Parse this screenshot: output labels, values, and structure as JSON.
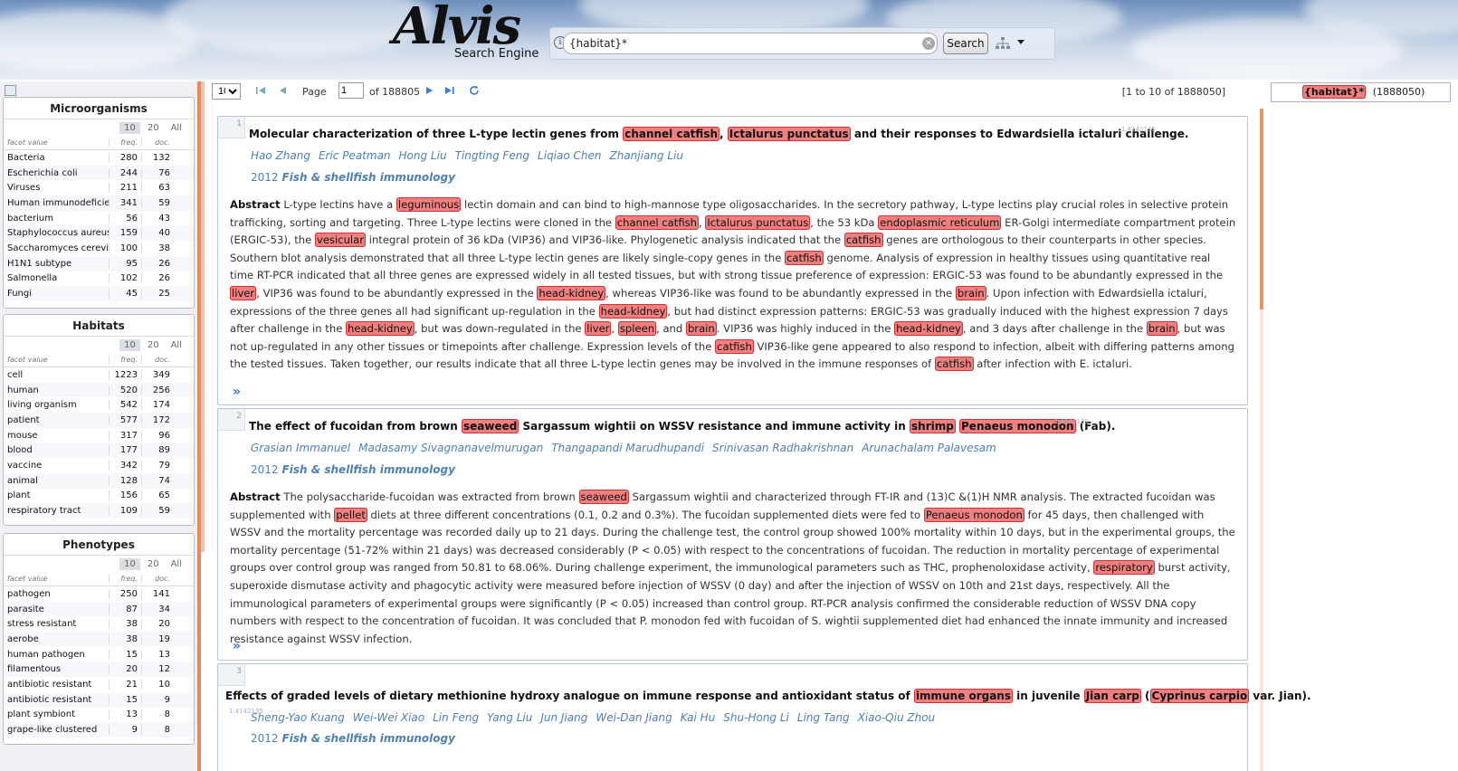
{
  "header": {
    "logo_main": "Alvis",
    "logo_sub": "Search Engine",
    "search_value": "{habitat}*",
    "search_button": "Search"
  },
  "toolbar": {
    "page_size": "10",
    "page_label": "Page",
    "page_value": "1",
    "page_total": "of 188805",
    "range": "[1 to 10 of 1888050]"
  },
  "query_chip": {
    "term": "{habitat}*",
    "count": "(1888050)"
  },
  "facets": [
    {
      "title": "Microorganisms",
      "limits": [
        "10",
        "20",
        "All"
      ],
      "headers": [
        "facet value",
        "freq.",
        "doc."
      ],
      "rows": [
        [
          "Bacteria",
          "280",
          "132"
        ],
        [
          "Escherichia coli",
          "244",
          "76"
        ],
        [
          "Viruses",
          "211",
          "63"
        ],
        [
          "Human immunodeficier",
          "341",
          "59"
        ],
        [
          "bacterium",
          "56",
          "43"
        ],
        [
          "Staphylococcus aureus",
          "159",
          "40"
        ],
        [
          "Saccharomyces cerevis",
          "100",
          "38"
        ],
        [
          "H1N1 subtype",
          "95",
          "26"
        ],
        [
          "Salmonella",
          "102",
          "26"
        ],
        [
          "Fungi",
          "45",
          "25"
        ]
      ]
    },
    {
      "title": "Habitats",
      "limits": [
        "10",
        "20",
        "All"
      ],
      "headers": [
        "facet value",
        "freq.",
        "doc."
      ],
      "rows": [
        [
          "cell",
          "1223",
          "349"
        ],
        [
          "human",
          "520",
          "256"
        ],
        [
          "living organism",
          "542",
          "174"
        ],
        [
          "patient",
          "577",
          "172"
        ],
        [
          "mouse",
          "317",
          "96"
        ],
        [
          "blood",
          "177",
          "89"
        ],
        [
          "vaccine",
          "342",
          "79"
        ],
        [
          "animal",
          "128",
          "74"
        ],
        [
          "plant",
          "156",
          "65"
        ],
        [
          "respiratory tract",
          "109",
          "59"
        ]
      ]
    },
    {
      "title": "Phenotypes",
      "limits": [
        "10",
        "20",
        "All"
      ],
      "headers": [
        "facet value",
        "freq.",
        "doc."
      ],
      "rows": [
        [
          "pathogen",
          "250",
          "141"
        ],
        [
          "parasite",
          "87",
          "34"
        ],
        [
          "stress resistant",
          "38",
          "20"
        ],
        [
          "aerobe",
          "38",
          "19"
        ],
        [
          "human pathogen",
          "15",
          "13"
        ],
        [
          "filamentous",
          "20",
          "12"
        ],
        [
          "antibiotic resistant",
          "21",
          "10"
        ],
        [
          "antibiotic resistant",
          "15",
          "9"
        ],
        [
          "plant symbiont",
          "13",
          "8"
        ],
        [
          "grape-like clustered",
          "9",
          "8"
        ]
      ]
    }
  ],
  "results": [
    {
      "rank": "1",
      "docid": "1.4142135",
      "title_parts": [
        [
          "Molecular characterization of three L-type lectin genes from ",
          false
        ],
        [
          "channel catfish",
          true
        ],
        [
          ", ",
          false
        ],
        [
          "Ictalurus punctatus",
          true
        ],
        [
          " and their responses to Edwardsiella ictaluri challenge.",
          false
        ]
      ],
      "authors": [
        "Hao Zhang",
        "Eric Peatman",
        "Hong Liu",
        "Tingting Feng",
        "Liqiao Chen",
        "Zhanjiang Liu"
      ],
      "year": "2012",
      "journal": "Fish & shellfish immunology",
      "abstract_label": "Abstract",
      "abstract_parts": [
        [
          " L-type lectins have a ",
          false
        ],
        [
          "leguminous",
          true
        ],
        [
          " lectin domain and can bind to high-mannose type oligosaccharides. In the secretory pathway, L-type lectins play crucial roles in selective protein trafficking, sorting and targeting. Three L-type lectins were cloned in the ",
          false
        ],
        [
          "channel catfish",
          true
        ],
        [
          ", ",
          false
        ],
        [
          "Ictalurus punctatus",
          true
        ],
        [
          ", the 53 kDa ",
          false
        ],
        [
          "endoplasmic reticulum",
          true
        ],
        [
          " ER-Golgi intermediate compartment protein (ERGIC-53), the ",
          false
        ],
        [
          "vesicular",
          true
        ],
        [
          " integral protein of 36 kDa (VIP36) and VIP36-like. Phylogenetic analysis indicated that the ",
          false
        ],
        [
          "catfish",
          true
        ],
        [
          " genes are orthologous to their counterparts in other species. Southern blot analysis demonstrated that all three L-type lectin genes are likely single-copy genes in the ",
          false
        ],
        [
          "catfish",
          true
        ],
        [
          " genome. Analysis of expression in healthy tissues using quantitative real time RT-PCR indicated that all three genes are expressed widely in all tested tissues, but with strong tissue preference of expression: ERGIC-53 was found to be abundantly expressed in the ",
          false
        ],
        [
          "liver",
          true
        ],
        [
          ", VIP36 was found to be abundantly expressed in the ",
          false
        ],
        [
          "head-kidney",
          true
        ],
        [
          ", whereas VIP36-like was found to be abundantly expressed in the ",
          false
        ],
        [
          "brain",
          true
        ],
        [
          ". Upon infection with Edwardsiella ictaluri, expressions of the three genes all had significant up-regulation in the ",
          false
        ],
        [
          "head-kidney",
          true
        ],
        [
          ", but had distinct expression patterns: ERGIC-53 was gradually induced with the highest expression 7 days after challenge in the ",
          false
        ],
        [
          "head-kidney",
          true
        ],
        [
          ", but was down-regulated in the ",
          false
        ],
        [
          "liver",
          true
        ],
        [
          ", ",
          false
        ],
        [
          "spleen",
          true
        ],
        [
          ", and ",
          false
        ],
        [
          "brain",
          true
        ],
        [
          ". VIP36 was highly induced in the ",
          false
        ],
        [
          "head-kidney",
          true
        ],
        [
          ", and 3 days after challenge in the ",
          false
        ],
        [
          "brain",
          true
        ],
        [
          ", but was not up-regulated in any other tissues or timepoints after challenge. Expression levels of the ",
          false
        ],
        [
          "catfish",
          true
        ],
        [
          " VIP36-like gene appeared to also respond to infection, albeit with differing patterns among the tested tissues. Taken together, our results indicate that all three L-type lectin genes may be involved in the immune responses of ",
          false
        ],
        [
          "catfish",
          true
        ],
        [
          " after infection with E. ictaluri.",
          false
        ]
      ]
    },
    {
      "rank": "2",
      "docid": "1.4142135",
      "title_parts": [
        [
          "The effect of fucoidan from brown ",
          false
        ],
        [
          "seaweed",
          true
        ],
        [
          " Sargassum wightii on WSSV resistance and immune activity in ",
          false
        ],
        [
          "shrimp",
          true
        ],
        [
          " ",
          false
        ],
        [
          "Penaeus monodon",
          true
        ],
        [
          " (Fab).",
          false
        ]
      ],
      "authors": [
        "Grasian Immanuel",
        "Madasamy Sivagnanavelmurugan",
        "Thangapandi Marudhupandi",
        "Srinivasan Radhakrishnan",
        "Arunachalam Palavesam"
      ],
      "year": "2012",
      "journal": "Fish & shellfish immunology",
      "abstract_label": "Abstract",
      "abstract_parts": [
        [
          " The polysaccharide-fucoidan was extracted from brown ",
          false
        ],
        [
          "seaweed",
          true
        ],
        [
          " Sargassum wightii and characterized through FT-IR and (13)C &(1)H NMR analysis. The extracted fucoidan was supplemented with ",
          false
        ],
        [
          "pellet",
          true
        ],
        [
          " diets at three different concentrations (0.1, 0.2 and 0.3%). The fucoidan supplemented diets were fed to ",
          false
        ],
        [
          "Penaeus monodon",
          true
        ],
        [
          " for 45 days, then challenged with WSSV and the mortality percentage was recorded daily up to 21 days. During the challenge test, the control group showed 100% mortality within 10 days, but in the experimental groups, the mortality percentage (51-72% within 21 days) was decreased considerably (P < 0.05) with respect to the concentrations of fucoidan. The reduction in mortality percentage of experimental groups over control group was ranged from 50.81 to 68.06%. During challenge experiment, the immunological parameters such as THC, prophenoloxidase activity, ",
          false
        ],
        [
          "respiratory",
          true
        ],
        [
          " burst activity, superoxide dismutase activity and phagocytic activity were measured before injection of WSSV (0 day) and after the injection of WSSV on 10th and 21st days, respectively. All the immunological parameters of experimental groups were significantly (P < 0.05) increased than control group. RT-PCR analysis confirmed the considerable reduction of WSSV DNA copy numbers with respect to the concentration of fucoidan. It was concluded that P. monodon fed with fucoidan of S. wightii supplemented diet had enhanced the innate immunity and increased resistance against WSSV infection.",
          false
        ]
      ]
    },
    {
      "rank": "3",
      "docid": "1.4142135",
      "title_parts": [
        [
          "Effects of graded levels of dietary methionine hydroxy analogue on immune response and antioxidant status of ",
          false
        ],
        [
          "immune organs",
          true
        ],
        [
          " in juvenile ",
          false
        ],
        [
          "Jian carp",
          true
        ],
        [
          " (",
          false
        ],
        [
          "Cyprinus carpio",
          true
        ],
        [
          " var. Jian).",
          false
        ]
      ],
      "authors": [
        "Sheng-Yao Kuang",
        "Wei-Wei Xiao",
        "Lin Feng",
        "Yang Liu",
        "Jun Jiang",
        "Wei-Dan Jiang",
        "Kai Hu",
        "Shu-Hong Li",
        "Ling Tang",
        "Xiao-Qiu Zhou"
      ],
      "year": "2012",
      "journal": "Fish & shellfish immunology"
    }
  ]
}
